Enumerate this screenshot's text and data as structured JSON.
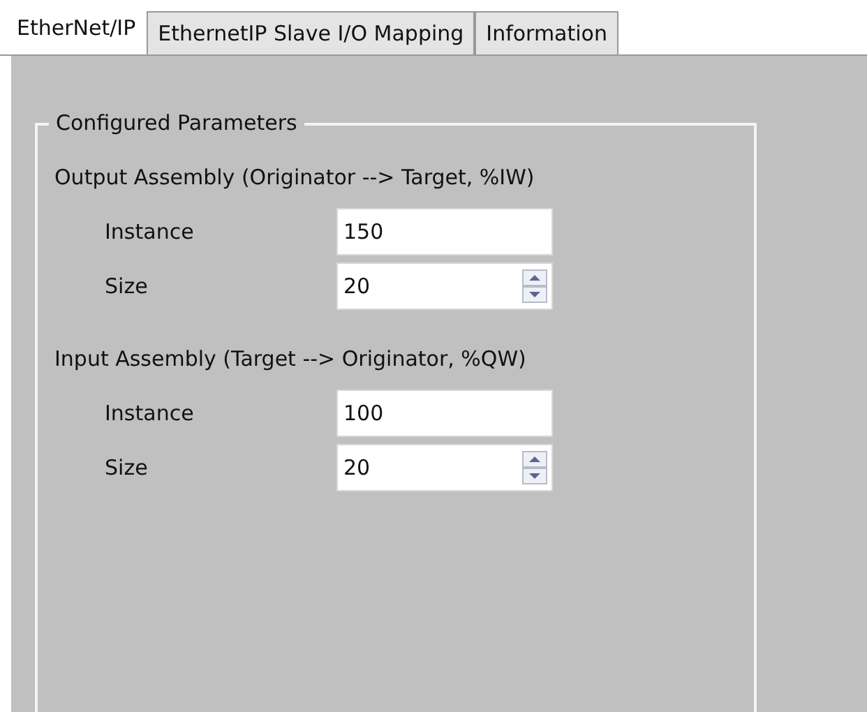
{
  "tabs": [
    {
      "label": "EtherNet/IP",
      "selected": true
    },
    {
      "label": "EthernetIP Slave I/O Mapping",
      "selected": false
    },
    {
      "label": "Information",
      "selected": false
    }
  ],
  "group": {
    "title": "Configured Parameters",
    "sections": [
      {
        "title": "Output Assembly (Originator --> Target, %IW)",
        "fields": [
          {
            "kind": "text",
            "label": "Instance",
            "value": "150"
          },
          {
            "kind": "spin",
            "label": "Size",
            "value": "20"
          }
        ]
      },
      {
        "title": "Input Assembly (Target --> Originator, %QW)",
        "fields": [
          {
            "kind": "text",
            "label": "Instance",
            "value": "100"
          },
          {
            "kind": "spin",
            "label": "Size",
            "value": "20"
          }
        ]
      }
    ]
  }
}
